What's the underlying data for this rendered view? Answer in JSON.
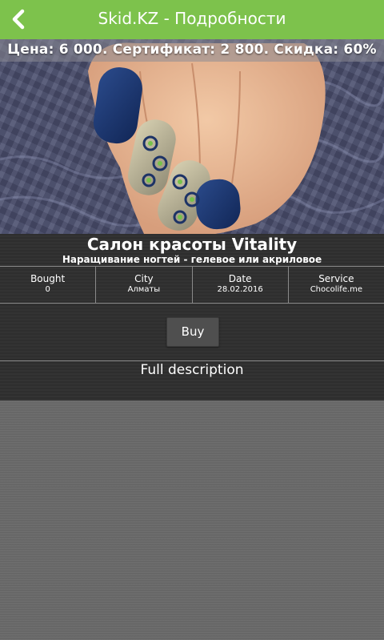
{
  "header": {
    "title": "Skid.KZ - Подробности",
    "back_icon": "chevron-left-icon",
    "color": "#7dc24c"
  },
  "hero": {
    "price_line": "Цена: 6 000. Сертификат: 2 800. Скидка: 60%"
  },
  "deal": {
    "title": "Салон красоты Vitality",
    "subtitle": "Наращивание ногтей - гелевое или акриловое",
    "stats": [
      {
        "label": "Bought",
        "value": "0"
      },
      {
        "label": "City",
        "value": "Алматы"
      },
      {
        "label": "Date",
        "value": "28.02.2016"
      },
      {
        "label": "Service",
        "value": "Chocolife.me"
      }
    ],
    "buy_label": "Buy",
    "full_description_label": "Full description"
  }
}
